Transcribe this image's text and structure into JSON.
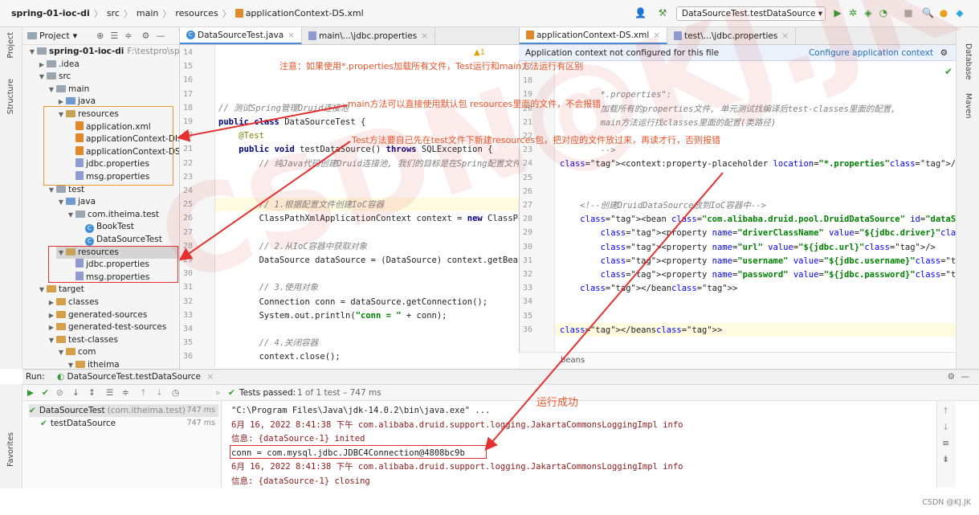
{
  "navbar": {
    "crumbs": [
      "spring-01-ioc-di",
      "src",
      "main",
      "resources",
      "applicationContext-DS.xml"
    ],
    "run_config": "DataSourceTest.testDataSource"
  },
  "stripes": {
    "project": "Project",
    "structure": "Structure",
    "favorites": "Favorites",
    "database": "Database",
    "maven": "Maven"
  },
  "project_panel": {
    "title": "Project",
    "tree": [
      {
        "label": "spring-01-ioc-di",
        "extra": "F:\\testpro\\spring",
        "kind": "module",
        "depth": 0
      },
      {
        "label": ".idea",
        "kind": "folder",
        "depth": 1
      },
      {
        "label": "src",
        "kind": "folder",
        "depth": 1
      },
      {
        "label": "main",
        "kind": "folder",
        "depth": 2
      },
      {
        "label": "java",
        "kind": "src",
        "depth": 3
      },
      {
        "label": "resources",
        "kind": "res",
        "depth": 3
      },
      {
        "label": "application.xml",
        "kind": "xml",
        "depth": 4
      },
      {
        "label": "applicationContext-DI.",
        "kind": "xml",
        "depth": 4
      },
      {
        "label": "applicationContext-DS",
        "kind": "xml",
        "depth": 4
      },
      {
        "label": "jdbc.properties",
        "kind": "prop",
        "depth": 4
      },
      {
        "label": "msg.properties",
        "kind": "prop",
        "depth": 4
      },
      {
        "label": "test",
        "kind": "folder",
        "depth": 2
      },
      {
        "label": "java",
        "kind": "src",
        "depth": 3
      },
      {
        "label": "com.itheima.test",
        "kind": "folder",
        "depth": 4
      },
      {
        "label": "BookTest",
        "kind": "java",
        "depth": 5
      },
      {
        "label": "DataSourceTest",
        "kind": "java",
        "depth": 5
      },
      {
        "label": "resources",
        "kind": "res",
        "depth": 3
      },
      {
        "label": "jdbc.properties",
        "kind": "prop",
        "depth": 4
      },
      {
        "label": "msg.properties",
        "kind": "prop",
        "depth": 4
      },
      {
        "label": "target",
        "kind": "tgt",
        "depth": 1
      },
      {
        "label": "classes",
        "kind": "tgt",
        "depth": 2
      },
      {
        "label": "generated-sources",
        "kind": "tgt",
        "depth": 2
      },
      {
        "label": "generated-test-sources",
        "kind": "tgt",
        "depth": 2
      },
      {
        "label": "test-classes",
        "kind": "tgt",
        "depth": 2
      },
      {
        "label": "com",
        "kind": "tgt",
        "depth": 3
      },
      {
        "label": "itheima",
        "kind": "tgt",
        "depth": 4
      }
    ]
  },
  "left_tabs": [
    {
      "label": "DataSourceTest.java",
      "active": true
    },
    {
      "label": "main\\...\\jdbc.properties",
      "active": false
    }
  ],
  "right_tabs": [
    {
      "label": "applicationContext-DS.xml",
      "active": true
    },
    {
      "label": "test\\...\\jdbc.properties",
      "active": false
    }
  ],
  "left_editor": {
    "warning": "▲1",
    "lines": [
      {
        "n": "14",
        "text": ""
      },
      {
        "n": "15",
        "text": ""
      },
      {
        "n": "16",
        "text": ""
      },
      {
        "n": "17",
        "text": ""
      },
      {
        "n": "18",
        "text": "// 测试Spring管理Druid连接池",
        "cls": "cmt"
      },
      {
        "n": "19",
        "text": "public class DataSourceTest {",
        "cls": "kwline"
      },
      {
        "n": "20",
        "text": "    @Test",
        "cls": "ann"
      },
      {
        "n": "21",
        "text": "    public void testDataSource() throws SQLException {",
        "cls": "kwline"
      },
      {
        "n": "22",
        "text": "        // 纯Java代码创建Druid连接池, 我们的目标是在Spring配置文件中",
        "cls": "cmt"
      },
      {
        "n": "23",
        "text": ""
      },
      {
        "n": "24",
        "text": ""
      },
      {
        "n": "25",
        "text": "        // 1.根据配置文件创建IoC容器",
        "cls": "cmt"
      },
      {
        "n": "26",
        "text": "        ClassPathXmlApplicationContext context = new ClassPa"
      },
      {
        "n": "27",
        "text": ""
      },
      {
        "n": "28",
        "text": "        // 2.从IoC容器中获取对象",
        "cls": "cmt"
      },
      {
        "n": "29",
        "text": "        DataSource dataSource = (DataSource) context.getBean"
      },
      {
        "n": "30",
        "text": ""
      },
      {
        "n": "31",
        "text": "        // 3.使用对象",
        "cls": "cmt"
      },
      {
        "n": "32",
        "text": "        Connection conn = dataSource.getConnection();"
      },
      {
        "n": "33",
        "text": "        System.out.println(\"conn = \" + conn);"
      },
      {
        "n": "34",
        "text": ""
      },
      {
        "n": "35",
        "text": "        // 4.关闭容器",
        "cls": "cmt"
      },
      {
        "n": "36",
        "text": "        context.close();"
      }
    ]
  },
  "right_editor": {
    "warning_bar": "Application context not configured for this file",
    "warning_link": "Configure application context",
    "breadcrumb": "beans",
    "lines": [
      {
        "n": "17",
        "text": ""
      },
      {
        "n": "18",
        "text": ""
      },
      {
        "n": "19",
        "text": "        *.properties\":",
        "cls": "cmt"
      },
      {
        "n": "20",
        "text": "        加载所有的properties文件, 单元测试找编译后test-classes里面的配置,",
        "cls": "cmt"
      },
      {
        "n": "21",
        "text": "        main方法运行找classes里面的配置(类路径)",
        "cls": "cmt"
      },
      {
        "n": "22",
        "text": ""
      },
      {
        "n": "23",
        "text": "        -->",
        "cls": "cmt"
      },
      {
        "n": "24",
        "text": "<context:property-placeholder location=\"*.properties\"/>",
        "cls": "xml1"
      },
      {
        "n": "25",
        "text": ""
      },
      {
        "n": "26",
        "text": ""
      },
      {
        "n": "27",
        "text": "    <!--创建DruidDataSource放到IoC容器中-->",
        "cls": "cmt"
      },
      {
        "n": "28",
        "text": "    <bean class=\"com.alibaba.druid.pool.DruidDataSource\" id=\"dataSource\">",
        "cls": "xml2"
      },
      {
        "n": "29",
        "text": "        <property name=\"driverClassName\" value=\"${jdbc.driver}\"/>",
        "cls": "xml3"
      },
      {
        "n": "30",
        "text": "        <property name=\"url\" value=\"${jdbc.url}\"/>",
        "cls": "xml3"
      },
      {
        "n": "31",
        "text": "        <property name=\"username\" value=\"${jdbc.username}\"/>",
        "cls": "xml3"
      },
      {
        "n": "32",
        "text": "        <property name=\"password\" value=\"${jdbc.password}\"/>",
        "cls": "xml3"
      },
      {
        "n": "33",
        "text": "    </bean>",
        "cls": "xml4"
      },
      {
        "n": "34",
        "text": ""
      },
      {
        "n": "35",
        "text": ""
      },
      {
        "n": "36",
        "text": "</beans>",
        "cls": "xml4"
      }
    ]
  },
  "run_panel": {
    "label": "Run:",
    "tab": "DataSourceTest.testDataSource",
    "status": "Tests passed:",
    "status_detail": "1 of 1 test – 747 ms",
    "tests": [
      {
        "label": "DataSourceTest",
        "extra": "(com.itheima.test)",
        "time": "747 ms"
      },
      {
        "label": "testDataSource",
        "extra": "",
        "time": "747 ms"
      }
    ],
    "console": [
      {
        "text": "\"C:\\Program Files\\Java\\jdk-14.0.2\\bin\\java.exe\" ...",
        "plain": true
      },
      {
        "text": "6月 16, 2022 8:41:38 下午 com.alibaba.druid.support.logging.JakartaCommonsLoggingImpl info",
        "plain": false
      },
      {
        "text": "信息: {dataSource-1} inited",
        "plain": false
      },
      {
        "text": "conn = com.mysql.jdbc.JDBC4Connection@4808bc9b",
        "plain": true
      },
      {
        "text": "6月 16, 2022 8:41:38 下午 com.alibaba.druid.support.logging.JakartaCommonsLoggingImpl info",
        "plain": false
      },
      {
        "text": "信息: {dataSource-1} closing",
        "plain": false
      }
    ]
  },
  "annotations": {
    "note1": "注意：如果使用*.properties加载所有文件，Test运行和main方法运行有区别",
    "note2": "main方法可以直接使用默认包 resources里面的文件，不会报错",
    "note3": "Test方法要自己先在test文件下新建resources包，把对应的文件放过来，再读才行，否则报错",
    "note4": "运行成功"
  },
  "credit": "CSDN @KJ.JK",
  "watermark": "CSDN@KJ.JK",
  "colors": {
    "accent": "#4a88d8",
    "annotation": "#e8542a",
    "redbox": "#e53030",
    "pass": "#3a9a3a"
  }
}
